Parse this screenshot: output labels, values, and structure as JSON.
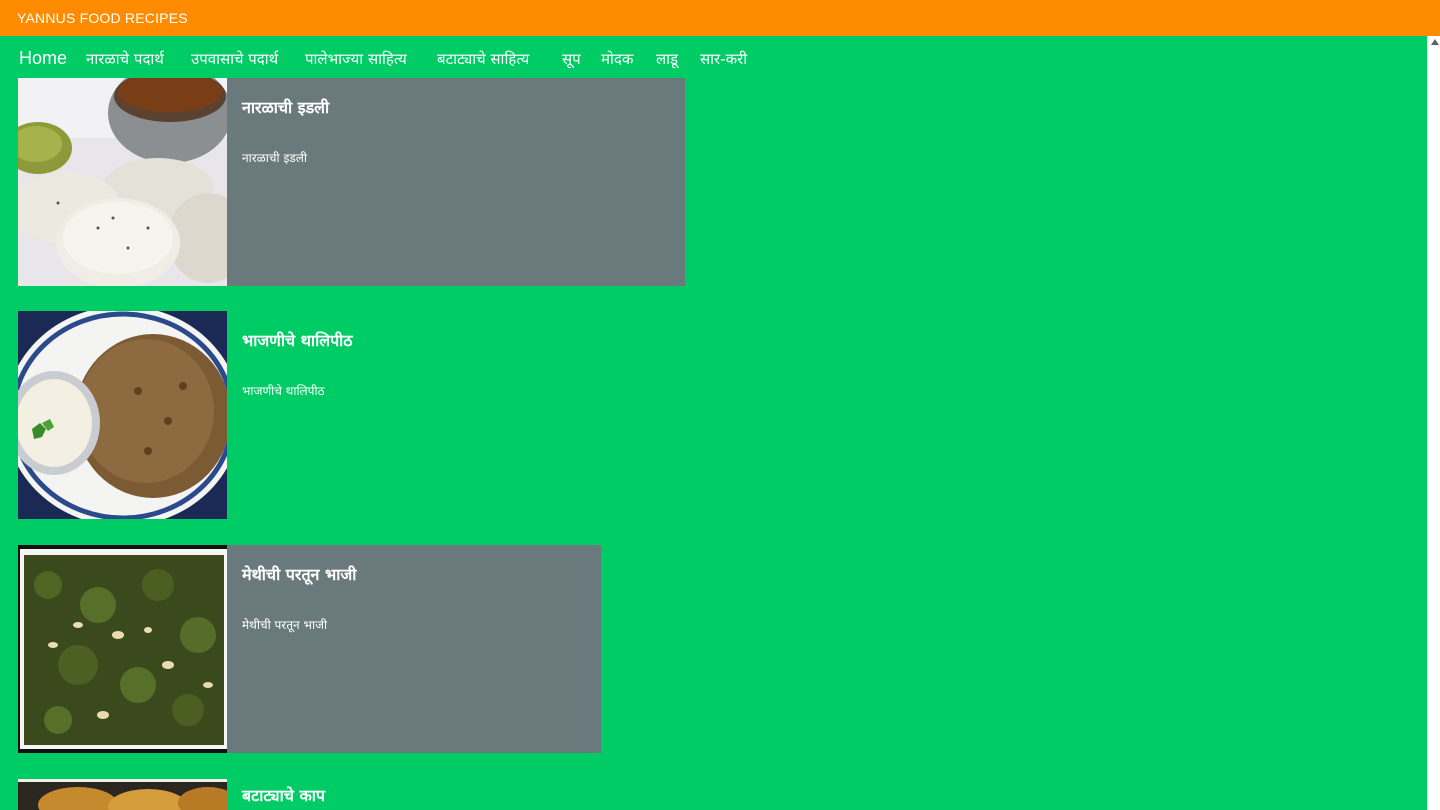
{
  "app": {
    "title": "YANNUS FOOD RECIPES"
  },
  "nav": {
    "items": [
      {
        "label": "Home"
      },
      {
        "label": "नारळाचे पदार्थ"
      },
      {
        "label": "उपवासाचे पदार्थ"
      },
      {
        "label": "पालेभाज्या साहित्य"
      },
      {
        "label": "बटाट्याचे साहित्य"
      },
      {
        "label": "सूप"
      },
      {
        "label": "मोदक"
      },
      {
        "label": "लाडू"
      },
      {
        "label": "सार-करी"
      }
    ]
  },
  "recipes": [
    {
      "title": "नारळाची इडली",
      "description": "नारळाची इडली",
      "image": "idli-photo"
    },
    {
      "title": "भाजणीचे थालिपीठ",
      "description": "भाजणीचे थालिपीठ",
      "image": "thalipeeth-photo"
    },
    {
      "title": "मेथीची परतून भाजी",
      "description": "मेथीची परतून भाजी",
      "image": "methi-bhaji-photo"
    },
    {
      "title": "बटाट्याचे काप",
      "description": "",
      "image": "batata-kaap-photo"
    }
  ],
  "colors": {
    "titlebar": "#ff8c00",
    "background": "#00cc66",
    "card": "#6a7a7c",
    "text": "#ffffff"
  }
}
